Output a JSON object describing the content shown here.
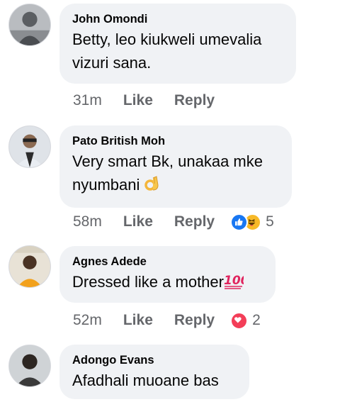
{
  "comments": [
    {
      "author": "John Omondi",
      "text_lines": [
        "Betty, leo kiukweli umevalia",
        "vizuri sana."
      ],
      "time": "31m",
      "like_label": "Like",
      "reply_label": "Reply",
      "reaction_icons": [],
      "reaction_count": ""
    },
    {
      "author": "Pato British Moh",
      "text_lines": [
        "Very smart Bk, unakaa mke",
        "nyumbani"
      ],
      "text_emoji": "ok-hand",
      "time": "58m",
      "like_label": "Like",
      "reply_label": "Reply",
      "reaction_icons": [
        "like-icon",
        "haha-icon"
      ],
      "reaction_count": "5"
    },
    {
      "author": "Agnes Adede",
      "text_lines": [
        "Dressed like a mother"
      ],
      "text_emoji": "hundred-points",
      "time": "52m",
      "like_label": "Like",
      "reply_label": "Reply",
      "reaction_icons": [
        "love-icon"
      ],
      "reaction_count": "2"
    },
    {
      "author": "Adongo Evans",
      "text_lines": [
        "Afadhali muoane bas"
      ],
      "time": "",
      "like_label": "",
      "reply_label": "",
      "reaction_icons": [],
      "reaction_count": ""
    }
  ],
  "colors": {
    "bubble_bg": "#f0f2f5",
    "meta_text": "#65676b",
    "like_blue": "#1877f2",
    "love_red": "#f33e58",
    "haha_yellow": "#f7b928"
  }
}
